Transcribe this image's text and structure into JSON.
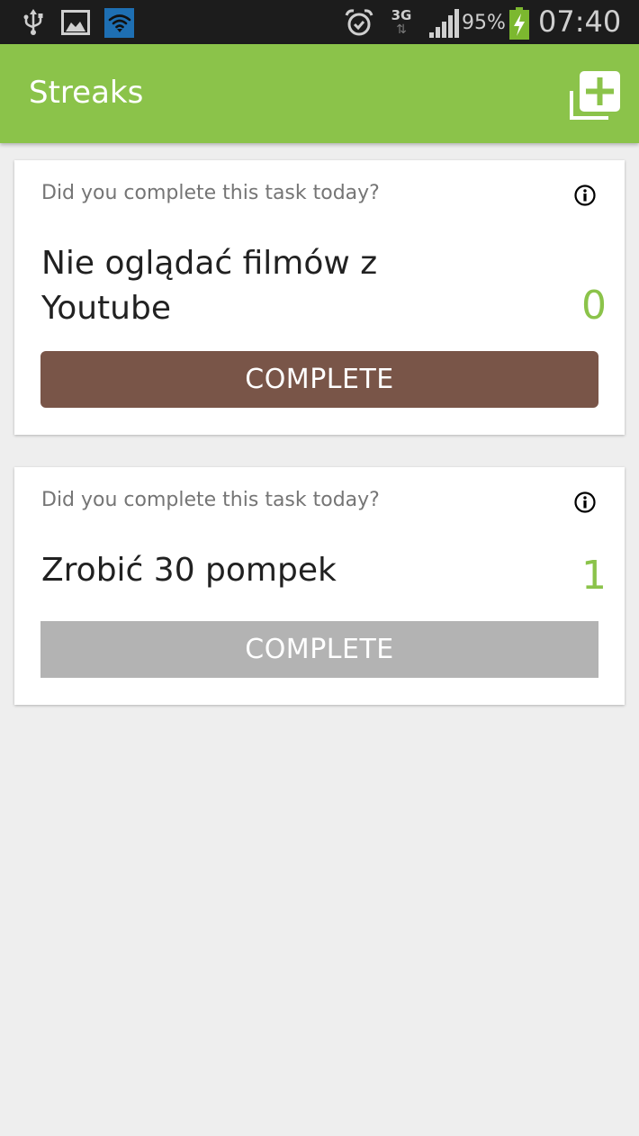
{
  "status_bar": {
    "icons": [
      "usb-icon",
      "image-icon",
      "wifi-icon",
      "alarm-icon",
      "3g-data-icon",
      "signal-icon",
      "battery-charging-icon"
    ],
    "network_type": "3G",
    "battery_percent": "95%",
    "time": "07:40",
    "wifi_badge_color": "#1e6fb3",
    "battery_color": "#7cb82f"
  },
  "app_bar": {
    "title": "Streaks",
    "add_icon": "add-task-icon",
    "color": "#8bc34a"
  },
  "tasks": [
    {
      "question": "Did you complete this task today?",
      "name": "Nie oglądać filmów z Youtube",
      "streak": "0",
      "button_label": "COMPLETE",
      "button_state": "enabled",
      "button_color": "#795548"
    },
    {
      "question": "Did you complete this task today?",
      "name": "Zrobić 30 pompek",
      "streak": "1",
      "button_label": "COMPLETE",
      "button_state": "disabled",
      "button_color": "#b3b3b3"
    }
  ]
}
